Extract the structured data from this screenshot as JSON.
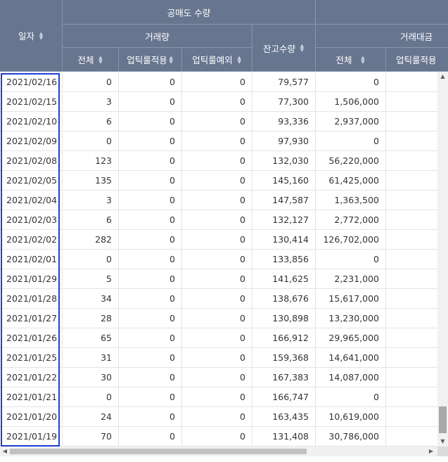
{
  "header": {
    "date_label": "일자",
    "short_qty_group": "공매도 수량",
    "volume_group": "거래량",
    "balance_label": "잔고수량",
    "amount_group": "거래대금",
    "total_label": "전체",
    "uptick_applied_label": "업틱룰적용",
    "uptick_exempt_label": "업틱룰예외",
    "amount_total_label": "전체",
    "amount_uptick_label": "업틱룰적용"
  },
  "rows": [
    {
      "date": "2021/02/16",
      "total": "0",
      "uptick_applied": "0",
      "uptick_exempt": "0",
      "balance": "79,577",
      "amount_total": "0"
    },
    {
      "date": "2021/02/15",
      "total": "3",
      "uptick_applied": "0",
      "uptick_exempt": "0",
      "balance": "77,300",
      "amount_total": "1,506,000"
    },
    {
      "date": "2021/02/10",
      "total": "6",
      "uptick_applied": "0",
      "uptick_exempt": "0",
      "balance": "93,336",
      "amount_total": "2,937,000"
    },
    {
      "date": "2021/02/09",
      "total": "0",
      "uptick_applied": "0",
      "uptick_exempt": "0",
      "balance": "97,930",
      "amount_total": "0"
    },
    {
      "date": "2021/02/08",
      "total": "123",
      "uptick_applied": "0",
      "uptick_exempt": "0",
      "balance": "132,030",
      "amount_total": "56,220,000"
    },
    {
      "date": "2021/02/05",
      "total": "135",
      "uptick_applied": "0",
      "uptick_exempt": "0",
      "balance": "145,160",
      "amount_total": "61,425,000"
    },
    {
      "date": "2021/02/04",
      "total": "3",
      "uptick_applied": "0",
      "uptick_exempt": "0",
      "balance": "147,587",
      "amount_total": "1,363,500"
    },
    {
      "date": "2021/02/03",
      "total": "6",
      "uptick_applied": "0",
      "uptick_exempt": "0",
      "balance": "132,127",
      "amount_total": "2,772,000"
    },
    {
      "date": "2021/02/02",
      "total": "282",
      "uptick_applied": "0",
      "uptick_exempt": "0",
      "balance": "130,414",
      "amount_total": "126,702,000"
    },
    {
      "date": "2021/02/01",
      "total": "0",
      "uptick_applied": "0",
      "uptick_exempt": "0",
      "balance": "133,856",
      "amount_total": "0"
    },
    {
      "date": "2021/01/29",
      "total": "5",
      "uptick_applied": "0",
      "uptick_exempt": "0",
      "balance": "141,625",
      "amount_total": "2,231,000"
    },
    {
      "date": "2021/01/28",
      "total": "34",
      "uptick_applied": "0",
      "uptick_exempt": "0",
      "balance": "138,676",
      "amount_total": "15,617,000"
    },
    {
      "date": "2021/01/27",
      "total": "28",
      "uptick_applied": "0",
      "uptick_exempt": "0",
      "balance": "130,898",
      "amount_total": "13,230,000"
    },
    {
      "date": "2021/01/26",
      "total": "65",
      "uptick_applied": "0",
      "uptick_exempt": "0",
      "balance": "166,912",
      "amount_total": "29,965,000"
    },
    {
      "date": "2021/01/25",
      "total": "31",
      "uptick_applied": "0",
      "uptick_exempt": "0",
      "balance": "159,368",
      "amount_total": "14,641,000"
    },
    {
      "date": "2021/01/22",
      "total": "30",
      "uptick_applied": "0",
      "uptick_exempt": "0",
      "balance": "167,383",
      "amount_total": "14,087,000"
    },
    {
      "date": "2021/01/21",
      "total": "0",
      "uptick_applied": "0",
      "uptick_exempt": "0",
      "balance": "166,747",
      "amount_total": "0"
    },
    {
      "date": "2021/01/20",
      "total": "24",
      "uptick_applied": "0",
      "uptick_exempt": "0",
      "balance": "163,435",
      "amount_total": "10,619,000"
    },
    {
      "date": "2021/01/19",
      "total": "70",
      "uptick_applied": "0",
      "uptick_exempt": "0",
      "balance": "131,408",
      "amount_total": "30,786,000"
    }
  ],
  "icons": {
    "sort": "sort-arrows-icon",
    "scroll_up": "arrow-up-icon",
    "scroll_down": "arrow-down-icon",
    "scroll_left": "arrow-left-icon",
    "scroll_right": "arrow-right-icon"
  },
  "colors": {
    "header_bg": "#67758f",
    "header_text": "#ffffff",
    "selection_border": "#1f3fd6",
    "grid_line": "#e4e4e4"
  }
}
